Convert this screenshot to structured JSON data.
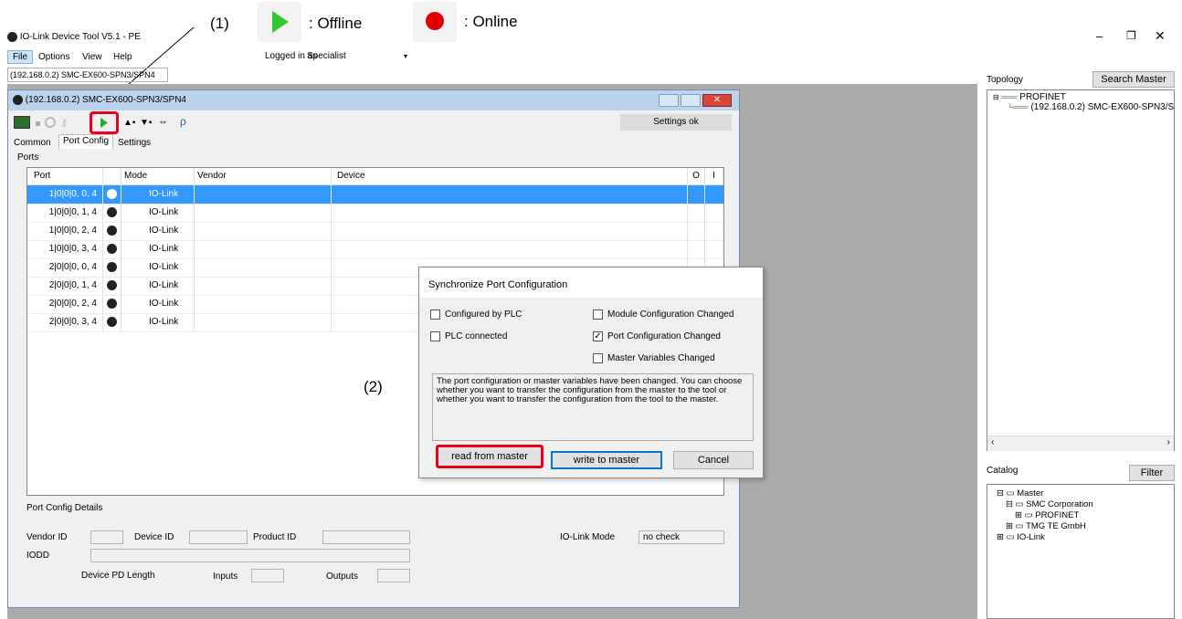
{
  "annotations": {
    "n1": "(1)",
    "offline_label": ": Offline",
    "online_label": ": Online",
    "n2": "(2)",
    "offline_color": "#32c832",
    "online_color": "#e00000"
  },
  "app": {
    "title": "IO-Link Device Tool V5.1 - PE",
    "menu": [
      "File",
      "Options",
      "View",
      "Help"
    ],
    "logged_in_label": "Logged in as",
    "user": "Specialist",
    "doc_tab": "(192.168.0.2) SMC-EX600-SPN3/SPN4"
  },
  "child": {
    "title": "(192.168.0.2) SMC-EX600-SPN3/SPN4",
    "status": "Settings ok",
    "tabs": [
      "Common",
      "Port Config",
      "Settings"
    ],
    "ports_group": "Ports",
    "columns": [
      "Port",
      "",
      "Mode",
      "Vendor",
      "Device",
      "O",
      "I"
    ],
    "rows": [
      {
        "port": "1|0|0|0, 0, 4",
        "mode": "IO-Link"
      },
      {
        "port": "1|0|0|0, 1, 4",
        "mode": "IO-Link"
      },
      {
        "port": "1|0|0|0, 2, 4",
        "mode": "IO-Link"
      },
      {
        "port": "1|0|0|0, 3, 4",
        "mode": "IO-Link"
      },
      {
        "port": "2|0|0|0, 0, 4",
        "mode": "IO-Link"
      },
      {
        "port": "2|0|0|0, 1, 4",
        "mode": "IO-Link"
      },
      {
        "port": "2|0|0|0, 2, 4",
        "mode": "IO-Link"
      },
      {
        "port": "2|0|0|0, 3, 4",
        "mode": "IO-Link"
      }
    ],
    "details": {
      "group": "Port Config Details",
      "vendor_id": "Vendor ID",
      "device_id": "Device ID",
      "product_id": "Product ID",
      "iolink_mode": "IO-Link Mode",
      "iolink_mode_value": "no check",
      "iodd": "IODD",
      "pd_length": "Device PD Length",
      "inputs": "Inputs",
      "outputs": "Outputs"
    }
  },
  "dialog": {
    "title": "Synchronize Port Configuration",
    "configured_by_plc": "Configured by PLC",
    "module_changed": "Module Configuration Changed",
    "plc_connected": "PLC connected",
    "port_changed": "Port Configuration Changed",
    "master_vars": "Master Variables Changed",
    "message": "The port configuration or master variables have been changed. You can choose whether you want to transfer the configuration from the master to the tool or whether you want to transfer the configuration from the tool to the master.",
    "read": "read from master",
    "write": "write to master",
    "cancel": "Cancel"
  },
  "topology": {
    "label": "Topology",
    "search": "Search Master",
    "root": "PROFINET",
    "child": "(192.168.0.2) SMC-EX600-SPN3/S"
  },
  "catalog": {
    "label": "Catalog",
    "filter": "Filter",
    "items": [
      "Master",
      "SMC Corporation",
      "PROFINET",
      "TMG TE GmbH",
      "IO-Link"
    ]
  }
}
